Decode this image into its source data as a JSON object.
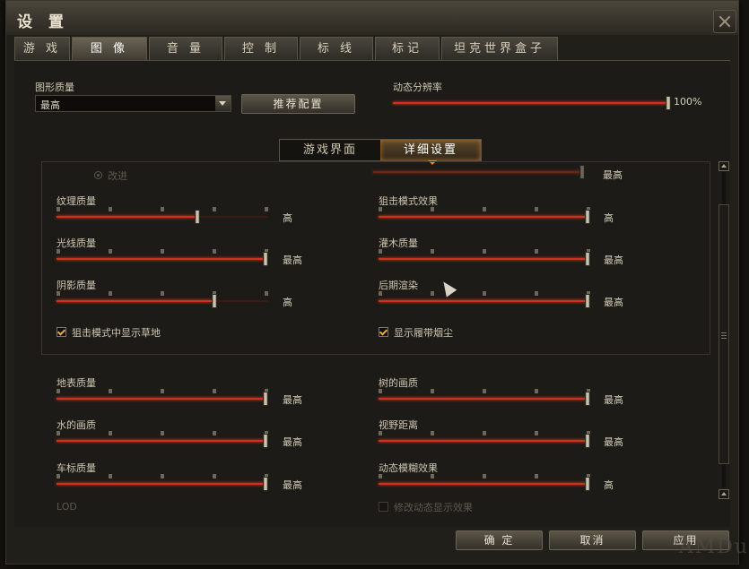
{
  "window": {
    "title": "设 置"
  },
  "tabs": [
    {
      "label": "游 戏",
      "active": false
    },
    {
      "label": "图 像",
      "active": true
    },
    {
      "label": "音 量",
      "active": false
    },
    {
      "label": "控 制",
      "active": false
    },
    {
      "label": "标 线",
      "active": false
    },
    {
      "label": "标记",
      "active": false
    },
    {
      "label": "坦克世界盒子",
      "active": false
    }
  ],
  "graphics_quality": {
    "label": "图形质量",
    "value": "最高",
    "recommend_button": "推荐配置"
  },
  "dynamic_resolution": {
    "label": "动态分辨率",
    "value_text": "100%",
    "level": 1.0
  },
  "subtabs": {
    "left": "游戏界面",
    "right": "详细设置",
    "active": "right"
  },
  "partial_top": {
    "radio_label": "改进",
    "right_value": "最高"
  },
  "sliders": {
    "texture": {
      "label": "纹理质量",
      "value_text": "高",
      "level": 0.67
    },
    "lighting": {
      "label": "光线质量",
      "value_text": "最高",
      "level": 1.0
    },
    "shadow": {
      "label": "阴影质量",
      "value_text": "高",
      "level": 0.75
    },
    "sniper_effects": {
      "label": "狙击模式效果",
      "value_text": "高",
      "level": 1.0
    },
    "shrubs": {
      "label": "灌木质量",
      "value_text": "最高",
      "level": 1.0
    },
    "postprocessing": {
      "label": "后期渲染",
      "value_text": "最高",
      "level": 1.0
    },
    "terrain": {
      "label": "地表质量",
      "value_text": "最高",
      "level": 1.0
    },
    "water": {
      "label": "水的画质",
      "value_text": "最高",
      "level": 1.0
    },
    "decals": {
      "label": "车标质量",
      "value_text": "最高",
      "level": 1.0
    },
    "trees": {
      "label": "树的画质",
      "value_text": "最高",
      "level": 1.0
    },
    "draw_distance": {
      "label": "视野距离",
      "value_text": "最高",
      "level": 1.0
    },
    "motion_blur": {
      "label": "动态模糊效果",
      "value_text": "高",
      "level": 1.0
    }
  },
  "checkboxes": {
    "sniper_grass": {
      "label": "狙击模式中显示草地",
      "checked": true
    },
    "track_dust": {
      "label": "显示履带烟尘",
      "checked": true
    },
    "dynamic_effects": {
      "label": "修改动态显示效果",
      "checked": false
    }
  },
  "lod_label": "LOD",
  "footer": {
    "ok": "确 定",
    "cancel": "取消",
    "apply": "应用"
  },
  "watermark": "AMDu"
}
